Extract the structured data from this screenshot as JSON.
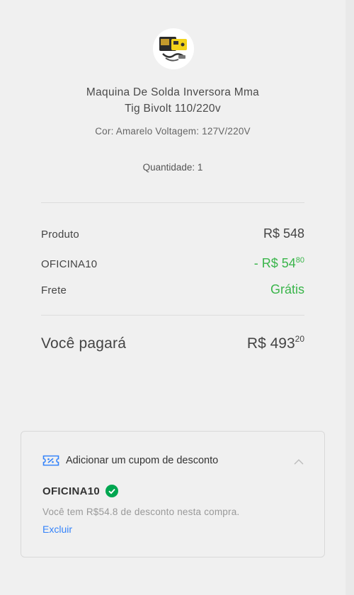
{
  "product": {
    "title_line1": "Maquina De Solda Inversora Mma",
    "title_line2": "Tig Bivolt 110/220v",
    "variant": "Cor: Amarelo Voltagem: 127V/220V",
    "quantity_label": "Quantidade: 1",
    "image_icon": "welding-machine-icon"
  },
  "summary": {
    "product_label": "Produto",
    "product_value": "R$ 548",
    "coupon_label": "OFICINA10",
    "coupon_value_main": "- R$ 54",
    "coupon_value_cents": "80",
    "shipping_label": "Frete",
    "shipping_value": "Grátis",
    "total_label": "Você pagará",
    "total_value_main": "R$ 493",
    "total_value_cents": "20"
  },
  "coupon": {
    "header": "Adicionar um cupom de desconto",
    "code": "OFICINA10",
    "note": "Você tem R$54.8 de desconto nesta compra.",
    "remove_label": "Excluir",
    "icons": [
      "ticket-icon",
      "chevron-up-icon",
      "check-circle-icon"
    ]
  },
  "colors": {
    "accent_green": "#39b54a",
    "link_blue": "#3483fa",
    "check_green": "#00a650"
  }
}
